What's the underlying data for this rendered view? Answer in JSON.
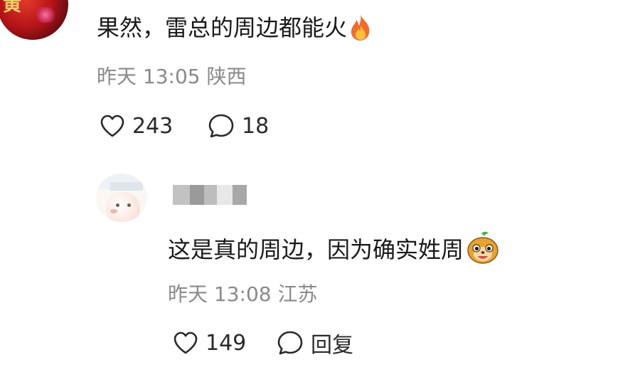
{
  "comment": {
    "text": "果然，雷总的周边都能火",
    "emoji": "fire-icon",
    "avatar_glyph": "黄",
    "time": "昨天 13:05",
    "location": "陕西",
    "likes": "243",
    "replies": "18"
  },
  "reply": {
    "text": "这是真的周边，因为确实姓周",
    "emoji": "meerkat-emoji-icon",
    "time": "昨天 13:08",
    "location": "江苏",
    "likes": "149",
    "reply_label": "回复"
  },
  "colors": {
    "text": "#1a1a1a",
    "meta": "#8a8a8a",
    "icon": "#2a2a2a",
    "avatar_red": "#b81418"
  }
}
